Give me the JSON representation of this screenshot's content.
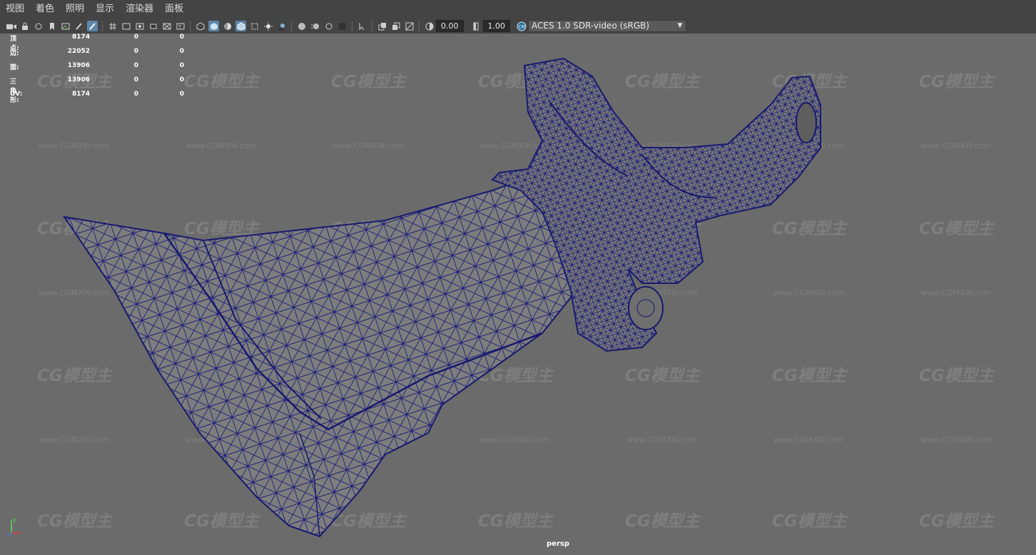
{
  "menu": [
    "视图",
    "着色",
    "照明",
    "显示",
    "渲染器",
    "面板"
  ],
  "toolbar": {
    "icons": [
      "camera-icon",
      "lock-camera-icon",
      "camera-attributes-icon",
      "bookmark-icon",
      "image-plane-icon",
      "grease-pencil-icon",
      "grid-icon",
      "film-gate-icon",
      "resolution-gate-icon",
      "gate-mask-icon",
      "field-chart-icon",
      "safe-title-icon",
      "wireframe-icon",
      "smooth-shade-icon",
      "use-default-material-icon",
      "wireframe-on-shaded-icon",
      "xray-icon",
      "lights-icon",
      "shadows-icon",
      "screen-space-ao-icon",
      "motion-blur-icon",
      "anti-aliasing-icon",
      "depth-of-field-icon",
      "isolate-select-icon",
      "xray-joints-icon",
      "xray-active-icon",
      "backface-icon",
      "exposure-icon",
      "gamma-icon",
      "color-management-icon"
    ],
    "exposure_value": "0.00",
    "gamma_value": "1.00",
    "color_space": "ACES 1.0 SDR-video (sRGB)"
  },
  "hud": {
    "rows": [
      {
        "label": "顶点:",
        "c1": "8174",
        "c2": "0",
        "c3": "0"
      },
      {
        "label": "边:",
        "c1": "22052",
        "c2": "0",
        "c3": "0"
      },
      {
        "label": "面:",
        "c1": "13906",
        "c2": "0",
        "c3": "0"
      },
      {
        "label": "三角形:",
        "c1": "13906",
        "c2": "0",
        "c3": "0"
      },
      {
        "label": "UV:",
        "c1": "8174",
        "c2": "0",
        "c3": "0"
      }
    ]
  },
  "watermark": {
    "logo_text": "CG模型主",
    "url": "www.CGMXW.com"
  },
  "camera_label": "persp",
  "axis": {
    "y": "y",
    "x": "x",
    "z": "z"
  }
}
